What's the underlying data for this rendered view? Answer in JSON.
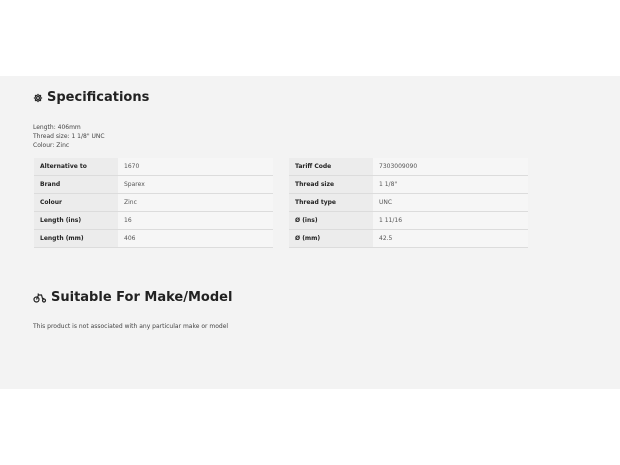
{
  "specifications": {
    "title": "Specifications",
    "icon": "gear-icon",
    "summary": [
      "Length: 406mm",
      "Thread size: 1 1/8\" UNC",
      "Colour: Zinc"
    ],
    "table_left": [
      {
        "label": "Alternative to",
        "value": "1670"
      },
      {
        "label": "Brand",
        "value": "Sparex"
      },
      {
        "label": "Colour",
        "value": "Zinc"
      },
      {
        "label": "Length (ins)",
        "value": "16"
      },
      {
        "label": "Length (mm)",
        "value": "406"
      }
    ],
    "table_right": [
      {
        "label": "Tariff Code",
        "value": "7303009090"
      },
      {
        "label": "Thread size",
        "value": "1 1/8\""
      },
      {
        "label": "Thread type",
        "value": "UNC"
      },
      {
        "label": "Ø (ins)",
        "value": "1 11/16"
      },
      {
        "label": "Ø (mm)",
        "value": "42.5"
      }
    ]
  },
  "suitable": {
    "title": "Suitable For Make/Model",
    "icon": "tractor-icon",
    "note": "This product is not associated with any particular make or model"
  }
}
